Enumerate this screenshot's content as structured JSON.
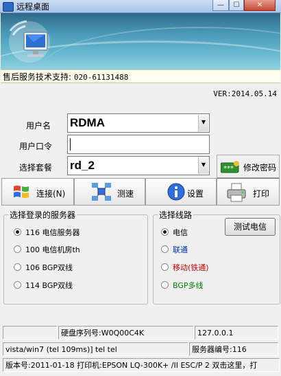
{
  "window": {
    "title": "远程桌面",
    "minimize_glyph": "—",
    "maximize_glyph": "☐",
    "close_glyph": "✕"
  },
  "support": {
    "label": "售后服务技术支持:",
    "phone": "020-61131488"
  },
  "version": "VER:2014.05.14",
  "form": {
    "username_label": "用户名",
    "username_value": "RDMA",
    "password_label": "用户口令",
    "password_value": "",
    "package_label": "选择套餐",
    "package_value": "rd_2",
    "change_password_label": "修改密码"
  },
  "toolbar": {
    "connect_label": "连接(N)",
    "speedtest_label": "测速",
    "settings_label": "设置",
    "print_label": "打印"
  },
  "server_group": {
    "legend": "选择登录的服务器",
    "options": [
      {
        "label": "116 电信服务器",
        "selected": true
      },
      {
        "label": "100 电信机房th",
        "selected": false
      },
      {
        "label": "106 BGP双线",
        "selected": false
      },
      {
        "label": "114 BGP双线",
        "selected": false
      }
    ]
  },
  "line_group": {
    "legend": "选择线路",
    "test_button": "测试电信",
    "options": [
      {
        "label": "电信",
        "selected": true,
        "color": "#000000"
      },
      {
        "label": "联通",
        "selected": false,
        "color": "#0033cc"
      },
      {
        "label": "移动(铁通)",
        "selected": false,
        "color": "#cc0000"
      },
      {
        "label": "BGP多线",
        "selected": false,
        "color": "#008000"
      }
    ]
  },
  "status": {
    "row1": [
      "",
      "硬盘序列号:W0Q00C4K",
      "127.0.0.1"
    ],
    "row2": [
      "vista/win7 (tel  109ms)]  tel  tel",
      "服务器编号:116"
    ],
    "row3": "版本号:2011-01-18  打印机:EPSON LQ-300K+ /II ESC/P 2   双击这里，打"
  },
  "icons": {
    "app": "remote-desktop-icon",
    "banner": "computer-monitor-icon",
    "change_password": "keyboard-password-icon",
    "connect": "windows-flag-icon",
    "speedtest": "network-nodes-icon",
    "settings": "info-icon",
    "print": "printer-icon"
  }
}
